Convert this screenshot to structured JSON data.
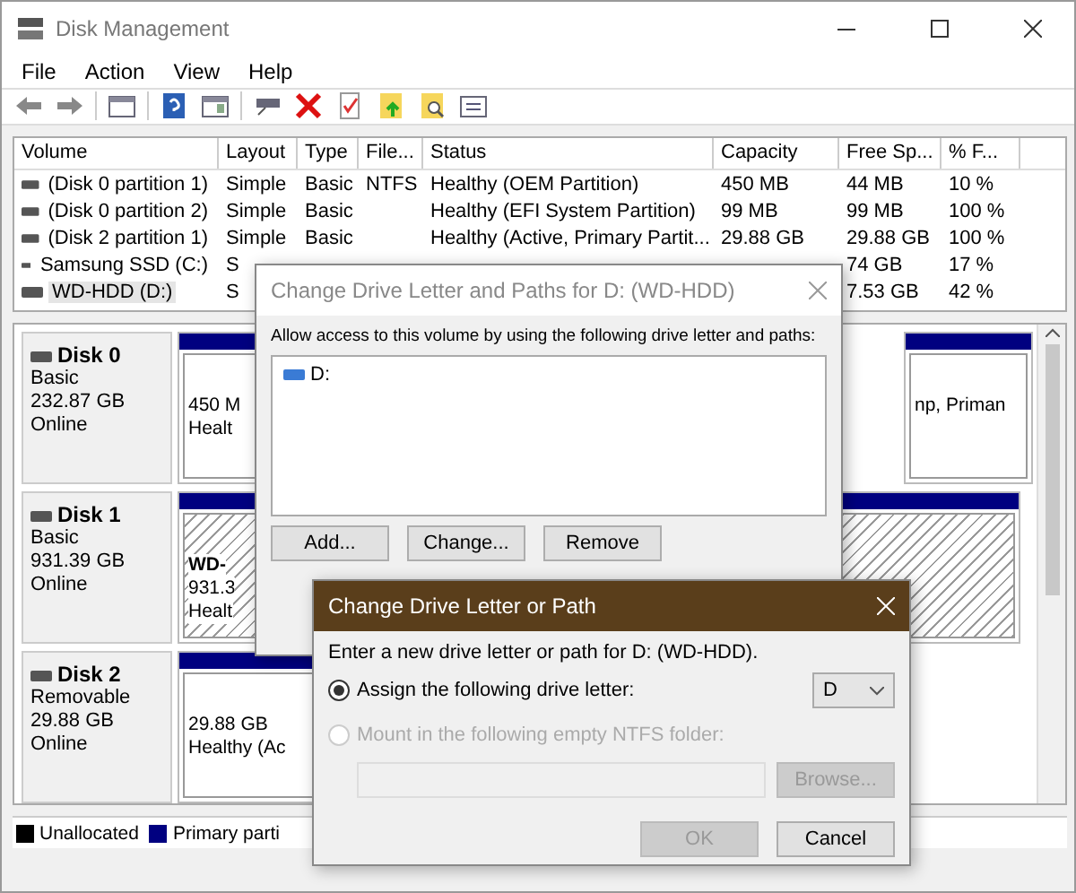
{
  "window": {
    "title": "Disk Management"
  },
  "menu": [
    "File",
    "Action",
    "View",
    "Help"
  ],
  "table": {
    "columns": [
      "Volume",
      "Layout",
      "Type",
      "File...",
      "Status",
      "Capacity",
      "Free Sp...",
      "% F..."
    ],
    "rows": [
      {
        "volume": "(Disk 0 partition 1)",
        "layout": "Simple",
        "type": "Basic",
        "file_system": "NTFS",
        "status": "Healthy (OEM Partition)",
        "capacity": "450 MB",
        "free_space": "44 MB",
        "percent_free": "10 %",
        "selected": false
      },
      {
        "volume": "(Disk 0 partition 2)",
        "layout": "Simple",
        "type": "Basic",
        "status": "Healthy (EFI System Partition)",
        "capacity": "99 MB",
        "free_space": "99 MB",
        "percent_free": "100 %",
        "selected": false
      },
      {
        "volume": "(Disk 2 partition 1)",
        "layout": "Simple",
        "type": "Basic",
        "status": "Healthy (Active, Primary Partit...",
        "capacity": "29.88 GB",
        "free_space": "29.88 GB",
        "percent_free": "100 %",
        "selected": false
      },
      {
        "volume": "Samsung SSD (C:)",
        "layout": "S",
        "free_space": "74 GB",
        "percent_free": "17 %",
        "selected": false
      },
      {
        "volume": "WD-HDD (D:)",
        "layout": "S",
        "free_space": "7.53 GB",
        "percent_free": "42 %",
        "selected": true
      }
    ]
  },
  "disks": [
    {
      "name": "Disk 0",
      "type": "Basic",
      "size": "232.87 GB",
      "state": "Online",
      "partitions": [
        {
          "lines": [
            "450 M",
            "Healt"
          ],
          "selected": false
        },
        {
          "lines": [
            "np, Priman"
          ],
          "selected": false
        }
      ]
    },
    {
      "name": "Disk 1",
      "type": "Basic",
      "size": "931.39 GB",
      "state": "Online",
      "partitions": [
        {
          "lines": [
            "WD-",
            "931.3",
            "Healt"
          ],
          "selected": true
        }
      ]
    },
    {
      "name": "Disk 2",
      "type": "Removable",
      "size": "29.88 GB",
      "state": "Online",
      "partitions": [
        {
          "lines": [
            "29.88 GB",
            "Healthy (Ac"
          ],
          "selected": false
        }
      ]
    }
  ],
  "legend": [
    {
      "label": "Unallocated",
      "color": "#000000"
    },
    {
      "label": "Primary parti",
      "color": "#000080"
    }
  ],
  "paths_dialog": {
    "title": "Change Drive Letter and Paths for D: (WD-HDD)",
    "instruction": "Allow access to this volume by using the following drive letter and paths:",
    "entries": [
      "D:"
    ],
    "buttons": [
      "Add...",
      "Change...",
      "Remove"
    ]
  },
  "letter_dialog": {
    "title": "Change Drive Letter or Path",
    "instruction": "Enter a new drive letter or path for D: (WD-HDD).",
    "options": [
      {
        "label": "Assign the following drive letter:",
        "selected": true,
        "disabled": false
      },
      {
        "label": "Mount in the following empty NTFS folder:",
        "selected": false,
        "disabled": true
      }
    ],
    "letter": "D",
    "browse": {
      "label": "Browse...",
      "disabled": true
    },
    "buttons": [
      {
        "label": "OK",
        "disabled": true
      },
      {
        "label": "Cancel",
        "disabled": false
      }
    ]
  }
}
